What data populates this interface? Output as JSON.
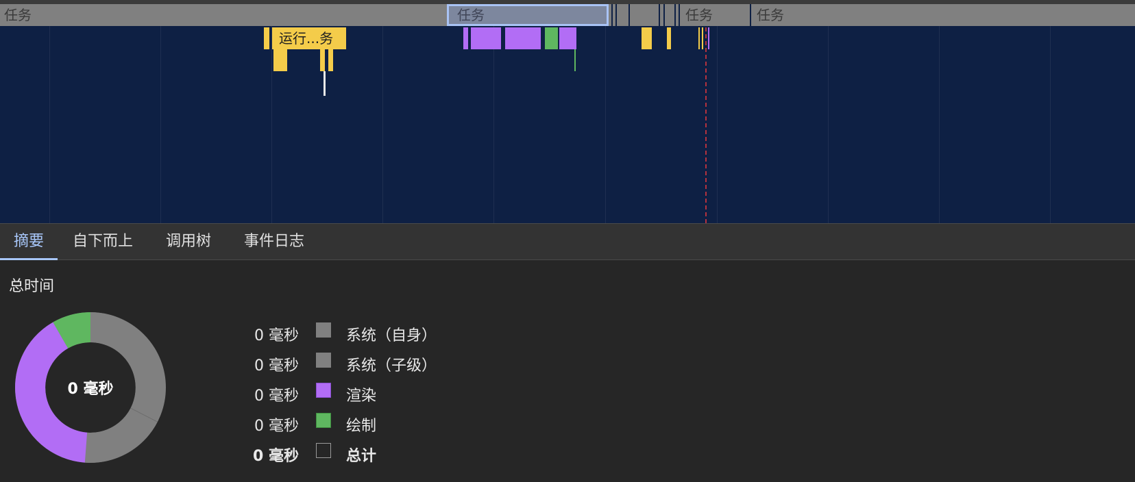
{
  "timeline": {
    "task_label": "任务",
    "selected_task_label": "任务",
    "run_task_label": "运行...务"
  },
  "tabs": [
    {
      "label": "摘要",
      "active": true
    },
    {
      "label": "自下而上",
      "active": false
    },
    {
      "label": "调用树",
      "active": false
    },
    {
      "label": "事件日志",
      "active": false
    }
  ],
  "summary": {
    "title": "总时间",
    "center_label": "0 毫秒",
    "legend": [
      {
        "value": "0 毫秒",
        "name": "系统（自身）",
        "color": "#808080"
      },
      {
        "value": "0 毫秒",
        "name": "系统（子级）",
        "color": "#808080"
      },
      {
        "value": "0 毫秒",
        "name": "渲染",
        "color": "#b26df5"
      },
      {
        "value": "0 毫秒",
        "name": "绘制",
        "color": "#5fb760"
      },
      {
        "value": "0 毫秒",
        "name": "总计",
        "color": "#262626"
      }
    ]
  },
  "colors": {
    "background": "#262626",
    "timeline_bg": "#0e2044",
    "scripting": "#f4cc4a",
    "rendering": "#b26df5",
    "painting": "#5fb760",
    "system": "#808080",
    "accent": "#a8c7fa"
  }
}
